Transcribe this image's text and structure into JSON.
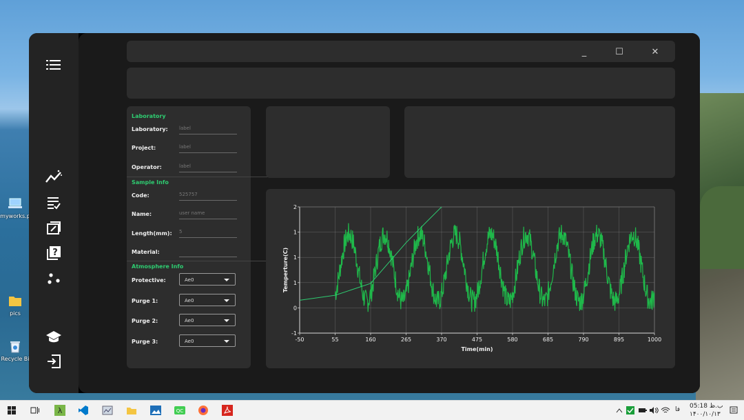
{
  "desktop": {
    "icons": [
      {
        "name": "myworks-icon",
        "label": "myworks.p"
      },
      {
        "name": "folder-icon",
        "label": "pics"
      },
      {
        "name": "recycle-bin-icon",
        "label": "Recycle Bi"
      }
    ]
  },
  "rail": {
    "icons": [
      "menu-icon",
      "chart-icon",
      "report-icon",
      "export-icon",
      "help-icon",
      "dots-icon",
      "graduation-icon",
      "logout-icon"
    ]
  },
  "window": {
    "minimize": "_",
    "maximize": "☐",
    "close": "✕"
  },
  "form": {
    "laboratory_section": "Laboratory",
    "laboratory_label": "Laboratory:",
    "laboratory_value": "label",
    "project_label": "Project:",
    "project_value": "label",
    "operator_label": "Operator:",
    "operator_value": "label",
    "sample_section": "Sample Info",
    "code_label": "Code:",
    "code_value": "525757",
    "name_label": "Name:",
    "name_placeholder": "user name",
    "length_label": "Length(mm):",
    "length_value": "5",
    "material_label": "Material:",
    "material_value": "",
    "atmosphere_section": "Atmosphere Info",
    "protective_label": "Protective:",
    "protective_value": "Ae0",
    "purge1_label": "Purge 1:",
    "purge1_value": "Ae0",
    "purge2_label": "Purge 2:",
    "purge2_value": "Ae0",
    "purge3_label": "Purge 3:",
    "purge3_value": "Ae0"
  },
  "chart_data": {
    "type": "line",
    "xlabel": "Time(min)",
    "ylabel": "Temperture(C)",
    "xlim": [
      -50,
      1000
    ],
    "ylim": [
      -1,
      2
    ],
    "xticks": [
      "-50",
      "55",
      "160",
      "265",
      "370",
      "475",
      "580",
      "685",
      "790",
      "895",
      "1000"
    ],
    "yticks": [
      "-1",
      "0",
      "1",
      "1",
      "1",
      "2"
    ],
    "grid": true,
    "series": [
      {
        "color": "#1fb84a",
        "style": "noisy-sine",
        "x_start": 55,
        "x_end": 1000,
        "period": 105,
        "center": 0.55,
        "amplitude": 0.8
      },
      {
        "color": "#2ecc71",
        "style": "exponential",
        "x": [
          -50,
          55,
          160,
          265,
          320,
          370
        ],
        "y": [
          -0.22,
          -0.1,
          0.18,
          1.15,
          1.6,
          2.0
        ]
      }
    ]
  },
  "taskbar": {
    "time": "05:18 ب.ظ",
    "date": "۱۴۰۰/۱۰/۱۳",
    "lang": "ﻓﺎ",
    "colors": {
      "vscode": "#007acc",
      "firefox": "#ff7139",
      "acrobat": "#d7261e",
      "lambda": "#7ab648",
      "qt": "#41cd52"
    }
  }
}
